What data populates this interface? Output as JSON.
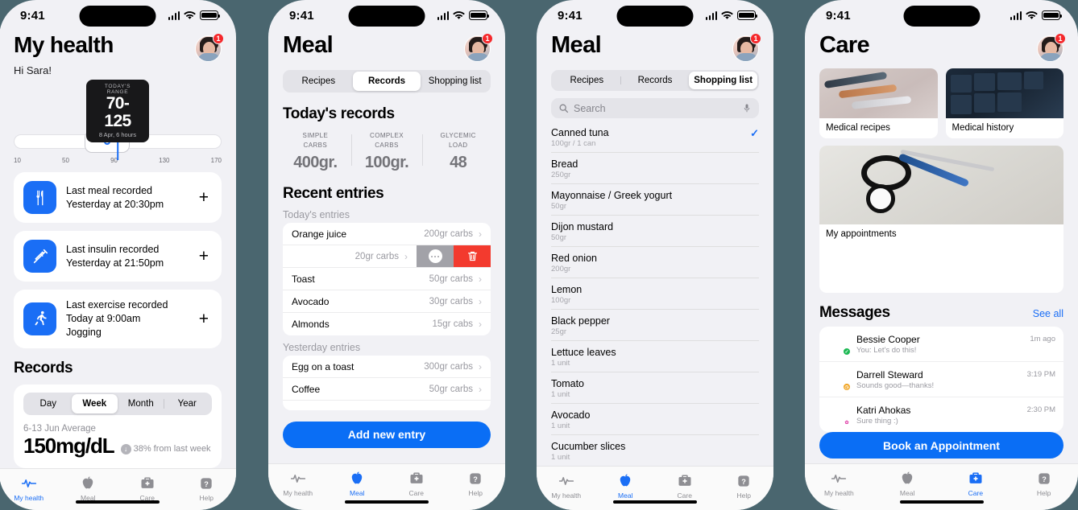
{
  "colors": {
    "accent": "#1a6ef5",
    "danger": "#f33a2e",
    "bg": "#f1f1f5",
    "page_bg": "#4a666f"
  },
  "status_bar": {
    "time": "9:41",
    "signal_icon": "cellular-bars-icon",
    "wifi_icon": "wifi-icon",
    "battery_icon": "battery-icon"
  },
  "avatar": {
    "badge_count": "1",
    "name": "user-avatar"
  },
  "tabbar": {
    "items": [
      {
        "label": "My health",
        "icon": "heart-pulse-icon"
      },
      {
        "label": "Meal",
        "icon": "apple-icon"
      },
      {
        "label": "Care",
        "icon": "medical-bag-icon"
      },
      {
        "label": "Help",
        "icon": "question-mark-icon"
      }
    ]
  },
  "screen1": {
    "title": "My health",
    "greeting": "Hi Sara!",
    "range_tooltip": {
      "label": "TODAY'S RANGE",
      "value": "70-125",
      "sub": "8 Apr, 6 hours"
    },
    "ticks": [
      "10",
      "50",
      "90",
      "130",
      "170"
    ],
    "cards": [
      {
        "icon": "cutlery-icon",
        "line1": "Last meal recorded",
        "line2": "Yesterday at 20:30pm",
        "line3": "",
        "action": "+"
      },
      {
        "icon": "syringe-icon",
        "line1": "Last insulin recorded",
        "line2": "Yesterday at 21:50pm",
        "line3": "",
        "action": "+"
      },
      {
        "icon": "running-icon",
        "line1": "Last exercise recorded",
        "line2": "Today at 9:00am",
        "line3": "Jogging",
        "action": "+"
      }
    ],
    "records": {
      "title": "Records",
      "periods": [
        "Day",
        "Week",
        "Month",
        "Year"
      ],
      "active_period": "Week",
      "average_label": "6-13 Jun Average",
      "average_value": "150mg/dL",
      "delta": "38% from last week",
      "delta_icon": "arrow-down-circle-icon"
    }
  },
  "screen2": {
    "title": "Meal",
    "tabs": [
      "Recipes",
      "Records",
      "Shopping list"
    ],
    "active_tab": "Records",
    "today_title": "Today's records",
    "stats": [
      {
        "label": "SIMPLE\nCARBS",
        "label_l1": "SIMPLE",
        "label_l2": "CARBS",
        "value": "400gr."
      },
      {
        "label": "COMPLEX\nCARBS",
        "label_l1": "COMPLEX",
        "label_l2": "CARBS",
        "value": "100gr."
      },
      {
        "label": "GLYCEMIC\nLOAD",
        "label_l1": "GLYCEMIC",
        "label_l2": "LOAD",
        "value": "48"
      }
    ],
    "recent_title": "Recent entries",
    "today_group": "Today's entries",
    "today_entries": [
      {
        "name": "Orange juice",
        "carbs": "200gr carbs",
        "swiped": false
      },
      {
        "name": "",
        "carbs": "20gr carbs",
        "swiped": true,
        "more_icon": "more-dots-icon",
        "delete_icon": "trash-icon"
      },
      {
        "name": "Toast",
        "carbs": "50gr carbs",
        "swiped": false
      },
      {
        "name": "Avocado",
        "carbs": "30gr carbs",
        "swiped": false
      },
      {
        "name": "Almonds",
        "carbs": "15gr cabs",
        "swiped": false
      }
    ],
    "yesterday_group": "Yesterday entries",
    "yesterday_entries": [
      {
        "name": "Egg on a toast",
        "carbs": "300gr carbs",
        "swiped": false
      },
      {
        "name": "Coffee",
        "carbs": "50gr carbs",
        "swiped": false
      }
    ],
    "add_button": "Add new entry"
  },
  "screen3": {
    "title": "Meal",
    "tabs": [
      "Recipes",
      "Records",
      "Shopping list"
    ],
    "active_tab": "Shopping list",
    "search": {
      "placeholder": "Search",
      "icon": "search-icon",
      "mic_icon": "microphone-icon"
    },
    "items": [
      {
        "name": "Canned tuna",
        "qty": "100gr / 1 can",
        "checked": true
      },
      {
        "name": "Bread",
        "qty": "250gr",
        "checked": false
      },
      {
        "name": "Mayonnaise / Greek yogurt",
        "qty": "50gr",
        "checked": false
      },
      {
        "name": "Dijon mustard",
        "qty": "50gr",
        "checked": false
      },
      {
        "name": "Red onion",
        "qty": "200gr",
        "checked": false
      },
      {
        "name": "Lemon",
        "qty": "100gr",
        "checked": false
      },
      {
        "name": "Black pepper",
        "qty": "25gr",
        "checked": false
      },
      {
        "name": "Lettuce leaves",
        "qty": "1 unit",
        "checked": false
      },
      {
        "name": "Tomato",
        "qty": "1 unit",
        "checked": false
      },
      {
        "name": "Avocado",
        "qty": "1 unit",
        "checked": false
      },
      {
        "name": "Cucumber slices",
        "qty": "1 unit",
        "checked": false
      }
    ],
    "check_icon": "checkmark-icon"
  },
  "screen4": {
    "title": "Care",
    "tiles": [
      {
        "caption": "Medical recipes",
        "image": "insulin-pens-photo"
      },
      {
        "caption": "Medical history",
        "image": "dashboard-charts-photo"
      },
      {
        "caption": "My appointments",
        "image": "stethoscope-photo"
      }
    ],
    "messages": {
      "title": "Messages",
      "see_all": "See all",
      "items": [
        {
          "name": "Bessie Cooper",
          "preview": "You: Let's do this!",
          "time": "1m ago",
          "status": "online-check-badge"
        },
        {
          "name": "Darrell Steward",
          "preview": "Sounds good—thanks!",
          "time": "3:19 PM",
          "status": "pending-clock-badge"
        },
        {
          "name": "Katri Ahokas",
          "preview": "Sure thing :)",
          "time": "2:30 PM",
          "status": "flower-badge"
        }
      ]
    },
    "book_button": "Book an Appointment"
  }
}
